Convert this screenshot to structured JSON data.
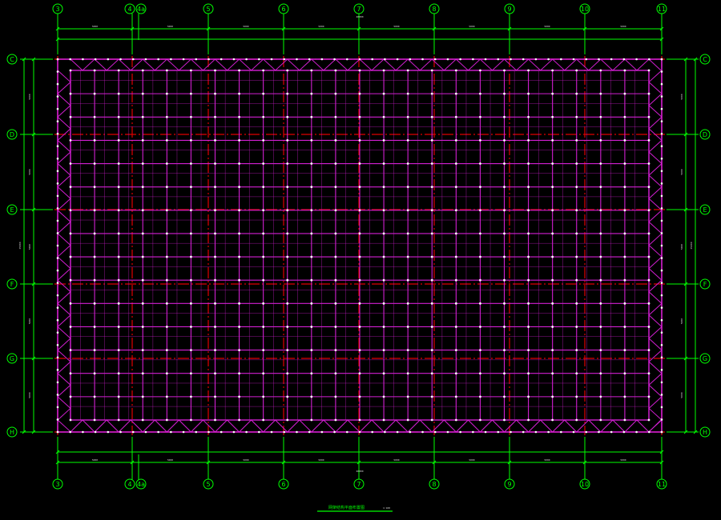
{
  "drawing": {
    "columns": [
      "3",
      "4",
      "4a",
      "5",
      "6",
      "7",
      "8",
      "9",
      "10",
      "11"
    ],
    "rows": [
      "C",
      "D",
      "E",
      "F",
      "G",
      "H"
    ],
    "top_dims": [
      "5000",
      "5000",
      "5000",
      "5000",
      "5000",
      "5000",
      "5000",
      "5000"
    ],
    "bottom_dims": [
      "5000",
      "5000",
      "5000",
      "5000",
      "5000",
      "5000",
      "5000",
      "5000"
    ],
    "top_total": "40000",
    "bottom_total": "40000",
    "left_dims": [
      "5000",
      "5000",
      "5000",
      "5000",
      "5000"
    ],
    "right_dims": [
      "5000",
      "5000",
      "5000",
      "5000",
      "5000"
    ],
    "left_total": "25000",
    "right_total": "25000",
    "title": "网架结构平面布置图",
    "scale": "1:100",
    "colors": {
      "grid_line": "#e00000",
      "member": "#d21fd2",
      "node": "#ffffff",
      "annotation": "#00ff00",
      "dim_text": "#dddddd",
      "background": "#000000"
    }
  }
}
